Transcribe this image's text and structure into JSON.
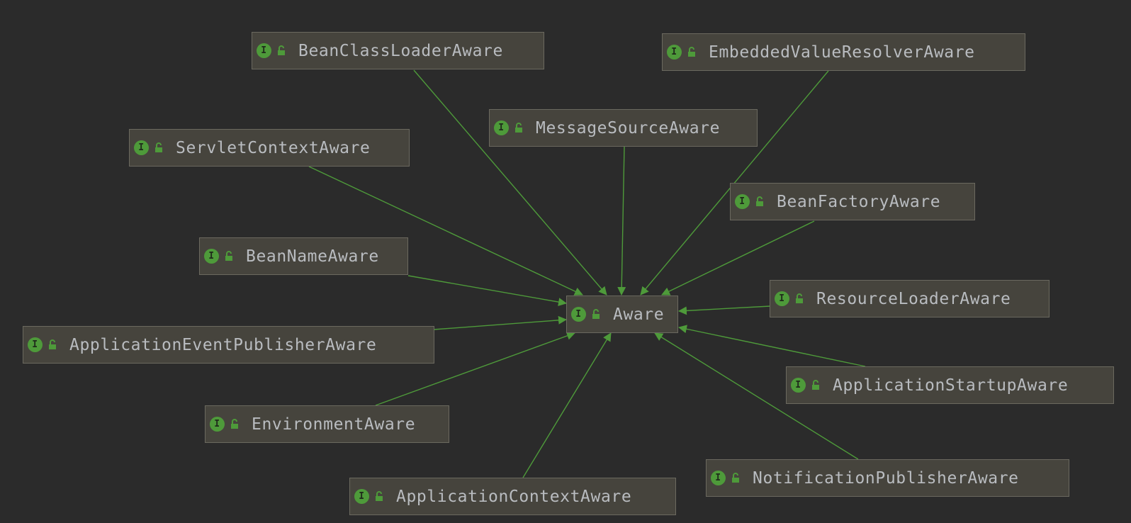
{
  "diagram": {
    "center": {
      "id": "aware",
      "label": "Aware",
      "badge": "I"
    },
    "nodes": [
      {
        "id": "bcl",
        "label": "BeanClassLoaderAware",
        "badge": "I"
      },
      {
        "id": "evr",
        "label": "EmbeddedValueResolverAware",
        "badge": "I"
      },
      {
        "id": "msa",
        "label": "MessageSourceAware",
        "badge": "I"
      },
      {
        "id": "sca",
        "label": "ServletContextAware",
        "badge": "I"
      },
      {
        "id": "bfa",
        "label": "BeanFactoryAware",
        "badge": "I"
      },
      {
        "id": "bna",
        "label": "BeanNameAware",
        "badge": "I"
      },
      {
        "id": "rla",
        "label": "ResourceLoaderAware",
        "badge": "I"
      },
      {
        "id": "aepa",
        "label": "ApplicationEventPublisherAware",
        "badge": "I"
      },
      {
        "id": "asa",
        "label": "ApplicationStartupAware",
        "badge": "I"
      },
      {
        "id": "ea",
        "label": "EnvironmentAware",
        "badge": "I"
      },
      {
        "id": "npa",
        "label": "NotificationPublisherAware",
        "badge": "I"
      },
      {
        "id": "aca",
        "label": "ApplicationContextAware",
        "badge": "I"
      }
    ],
    "edge_color": "#4e9a3a",
    "icons": {
      "badge": "interface-icon",
      "access": "unlock-icon"
    }
  }
}
